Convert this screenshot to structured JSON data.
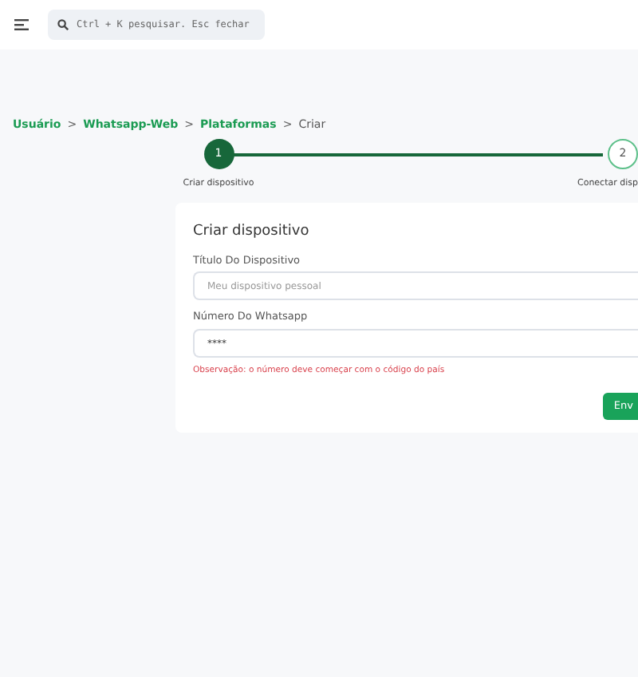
{
  "search": {
    "placeholder": "Ctrl + K pesquisar. Esc fechar"
  },
  "breadcrumb": [
    {
      "label": "Usuário",
      "link": true
    },
    {
      "label": "Whatsapp-Web",
      "link": true
    },
    {
      "label": "Plataformas",
      "link": true
    },
    {
      "label": "Criar",
      "link": false
    }
  ],
  "breadcrumb_separator": ">",
  "steps": [
    {
      "number": "1",
      "label": "Criar dispositivo",
      "selected": true
    },
    {
      "number": "2",
      "label": "Conectar disp",
      "selected": false
    }
  ],
  "form": {
    "title": "Criar dispositivo",
    "fields": [
      {
        "label": "Título Do Dispositivo",
        "placeholder": "Meu dispositivo pessoal"
      },
      {
        "label": "Número Do Whatsapp",
        "value": "****"
      }
    ],
    "note": "Observação: o número deve começar com o código do país",
    "submit": "Env"
  }
}
